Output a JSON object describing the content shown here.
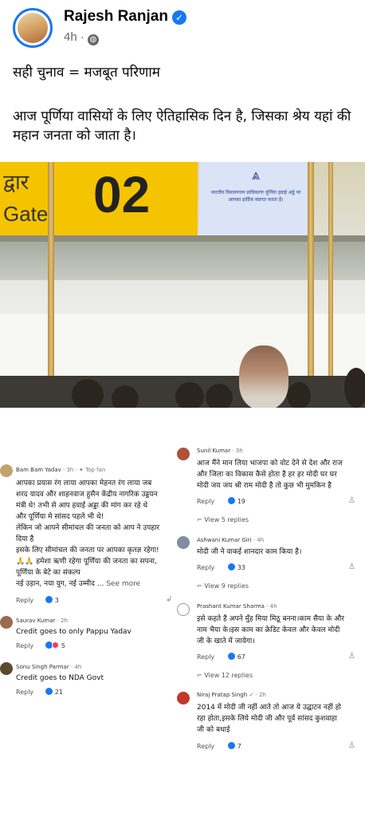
{
  "post": {
    "author": "Rajesh Ranjan",
    "time": "4h",
    "line1": "सही चुनाव = मजबूत परिणाम",
    "line2": "आज पूर्णिया वासियों के लिए ऐतिहासिक दिन है, जिसका श्रेय यहां की महान जनता को जाता है।"
  },
  "photo": {
    "gate_hindi": "द्वार",
    "gate_word": "Gate",
    "gate_number": "02",
    "sign_text": "भारतीय विमानपत्तन प्राधिकरण पूर्णिया हवाई अड्डे पर आपका हार्दिक स्वागत करता है।",
    "sign_logo": "AAI"
  },
  "reply_label": "Reply",
  "left_comments": [
    {
      "name": "Bam Bam Yadav",
      "time": "3h",
      "badge": "Top fan",
      "text": [
        "आपका प्रयास रंग लाया आपका मेहनत रंग लाया जब",
        "शरद यादव और शाहनवाज हुसैन केंद्रीय नागरिक उड्डयन",
        "मंत्री थे! तभी से आप हवाई अड्डा की मांग कर रहे थे",
        "और पूर्णिया मे सांसद पहले भी थे!",
        "लेकिन जो आपने सीमांचल की जनता को आप ने उपहार",
        "दिया है",
        "इसके लिए सीमांचल की जनता पर आपका कृतज्ञ रहेगा!",
        "🙏🙏 हमेशा ऋणी रहेगा पूर्णिया की जनता का सपना,",
        "पूर्णिया के बेटे का संकल्प",
        "नई उड़ान, नया युग, नई उम्मीद ..."
      ],
      "see_more": "See more",
      "reactions": "3"
    },
    {
      "name": "Saurav Kumar",
      "time": "2h",
      "text": [
        "Credit goes to only Pappu Yadav"
      ],
      "reactions": "5"
    },
    {
      "name": "Sonu Singh Parmar",
      "time": "4h",
      "text": [
        "Credit goes to NDA Govt"
      ],
      "reactions": "21"
    }
  ],
  "right_comments": [
    {
      "name": "Sunil Kumar",
      "time": "3h",
      "text": [
        "आज मैंने मान लिया भाजपा को वोट देने से देश और राज",
        "और जिला का विकास कैसे होता है हर हर मोदी घर घर",
        "मोदी जय जय श्री राम मोदी है तो कुछ भी मुमकिन है"
      ],
      "reactions": "19",
      "replies": "View 5 replies"
    },
    {
      "name": "Ashwani Kumar Giri",
      "time": "4h",
      "text": [
        "मोदी जी ने वाकई शानदार काम किया है।"
      ],
      "reactions": "33",
      "replies": "View 9 replies"
    },
    {
      "name": "Prashant Kumar Sharma",
      "time": "4h",
      "text": [
        "इसे कहते है अपने मुँह मिया मिठू बनना।काम सैया के और",
        "नाम भैया के।इस काम का क्रेडिट केवल और केवल मोदी",
        "जी के खाते में जायेगा।"
      ],
      "reactions": "67",
      "replies": "View 12 replies"
    },
    {
      "name": "Niraj Pratap Singh",
      "time": "2h",
      "text": [
        "2014 में मोदी जी नहीं आते तो आज ये उद्घाटन नहीं हो",
        "रहा होता,इसके लिये मोदी जी और पूर्व सांसद कुशवाहा",
        "जी को बधाई"
      ],
      "reactions": "7"
    }
  ],
  "colors": {
    "accent": "#1877f2",
    "text": "#050505",
    "muted": "#65676b",
    "gate_yellow": "#f4c400"
  }
}
